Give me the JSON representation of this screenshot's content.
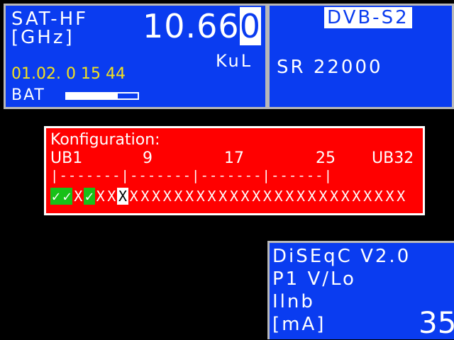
{
  "sat": {
    "label": "SAT-HF",
    "unit": "[GHz]",
    "frequency_main": "10.66",
    "frequency_cursor": "0",
    "band": "KuL",
    "datetime": "01.02. 0 15 44",
    "battery_label": "BAT",
    "battery_level_percent": 72
  },
  "signal": {
    "mode": "DVB-S2",
    "symbol_rate": "SR 22000"
  },
  "config": {
    "title": "Konfiguration:",
    "labels": [
      "UB1",
      "9",
      "17",
      "25",
      "UB32"
    ],
    "scale": "|-------|-------|-------|------|",
    "slots": [
      "✓",
      "✓",
      "X",
      "✓",
      "X",
      "X",
      "X",
      "X",
      "X",
      "X",
      "X",
      "X",
      "X",
      "X",
      "X",
      "X",
      "X",
      "X",
      "X",
      "X",
      "X",
      "X",
      "X",
      "X",
      "X",
      "X",
      "X",
      "X",
      "X",
      "X",
      "X",
      "X"
    ],
    "slot_states": [
      "ok",
      "ok",
      "x",
      "ok",
      "x",
      "x",
      "sel",
      "x",
      "x",
      "x",
      "x",
      "x",
      "x",
      "x",
      "x",
      "x",
      "x",
      "x",
      "x",
      "x",
      "x",
      "x",
      "x",
      "x",
      "x",
      "x",
      "x",
      "x",
      "x",
      "x",
      "x",
      "x"
    ]
  },
  "lnb": {
    "diseqc": "DiSEqC  V2.0",
    "position": "P1  V/Lo",
    "current_label": "Ilnb",
    "current_unit": "[mA]",
    "current_value": "35"
  },
  "colors": {
    "panel": "#0a3cf0",
    "config_bg": "#ff0000",
    "ok": "#18c018",
    "time": "#f4e21e"
  }
}
